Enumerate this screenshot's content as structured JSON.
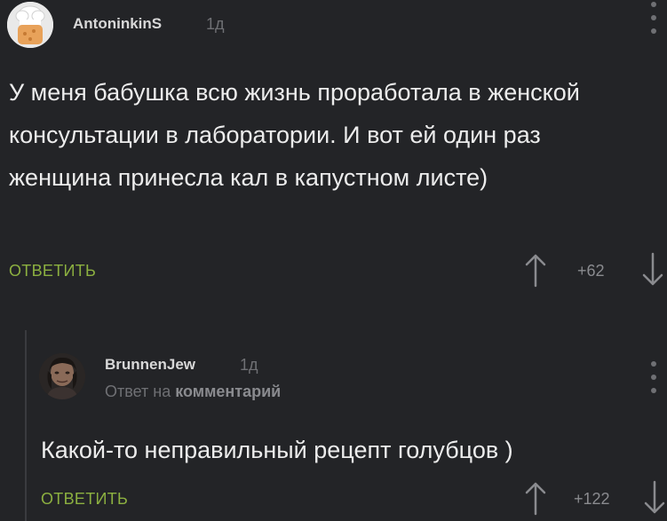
{
  "comments": [
    {
      "username": "AntoninkinS",
      "time": "1д",
      "text": "У меня бабушка всю жизнь проработала в женской консультации в лаборатории. И вот ей один раз женщина принесла кал в капустном листе)",
      "reply_label": "ОТВЕТИТЬ",
      "score": "+62"
    },
    {
      "username": "BrunnenJew",
      "time": "1д",
      "reply_to_prefix": "Ответ на",
      "reply_to_link": "комментарий",
      "text": "Какой-то неправильный рецепт голубцов )",
      "reply_label": "ОТВЕТИТЬ",
      "score": "+122"
    }
  ],
  "colors": {
    "background": "#232427",
    "accent_reply": "#8cb040",
    "muted": "#6f7074",
    "text": "#ececec"
  },
  "icons": [
    "chef-avatar-icon",
    "user-photo-avatar",
    "upvote-arrow-icon",
    "downvote-arrow-icon",
    "more-dots-icon"
  ]
}
